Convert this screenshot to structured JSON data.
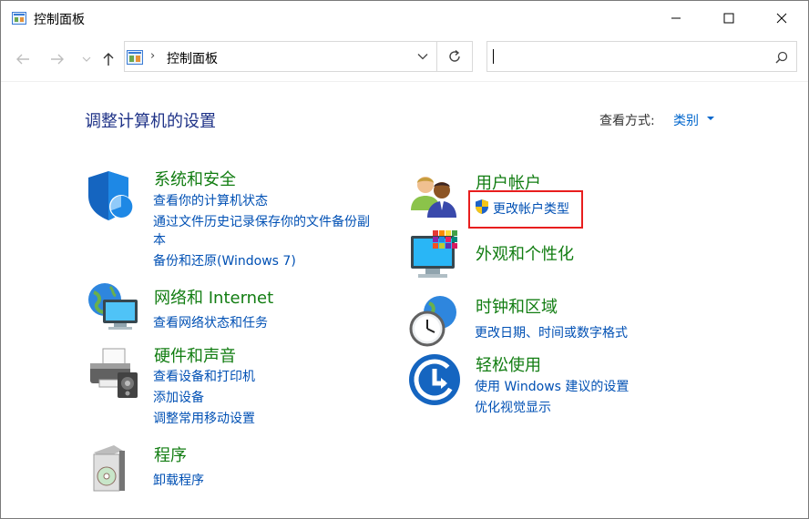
{
  "window": {
    "title": "控制面板"
  },
  "address": {
    "crumb": "控制面板"
  },
  "search": {
    "placeholder": "",
    "value": ""
  },
  "header": {
    "title": "调整计算机的设置",
    "view_label": "查看方式:",
    "view_value": "类别"
  },
  "categories": [
    {
      "title": "系统和安全",
      "links": [
        "查看你的计算机状态",
        "通过文件历史记录保存你的文件备份副",
        "本",
        "备份和还原(Windows 7)"
      ]
    },
    {
      "title": "网络和 Internet",
      "links": [
        "查看网络状态和任务"
      ]
    },
    {
      "title": "硬件和声音",
      "links": [
        "查看设备和打印机",
        "添加设备",
        "调整常用移动设置"
      ]
    },
    {
      "title": "程序",
      "links": [
        "卸载程序"
      ]
    },
    {
      "title": "用户帐户",
      "links": [
        "更改帐户类型"
      ]
    },
    {
      "title": "外观和个性化",
      "links": []
    },
    {
      "title": "时钟和区域",
      "links": [
        "更改日期、时间或数字格式"
      ]
    },
    {
      "title": "轻松使用",
      "links": [
        "使用 Windows 建议的设置",
        "优化视觉显示"
      ]
    }
  ],
  "icons": {
    "app": "control-panel-icon",
    "back": "back-arrow-icon",
    "forward": "forward-arrow-icon",
    "recent": "chevron-down-icon",
    "up": "up-arrow-icon",
    "refresh": "refresh-icon",
    "search": "search-icon"
  },
  "colors": {
    "category_title": "#127d12",
    "link": "#0050b4",
    "page_title": "#1e3287",
    "highlight": "#e81e1e"
  }
}
